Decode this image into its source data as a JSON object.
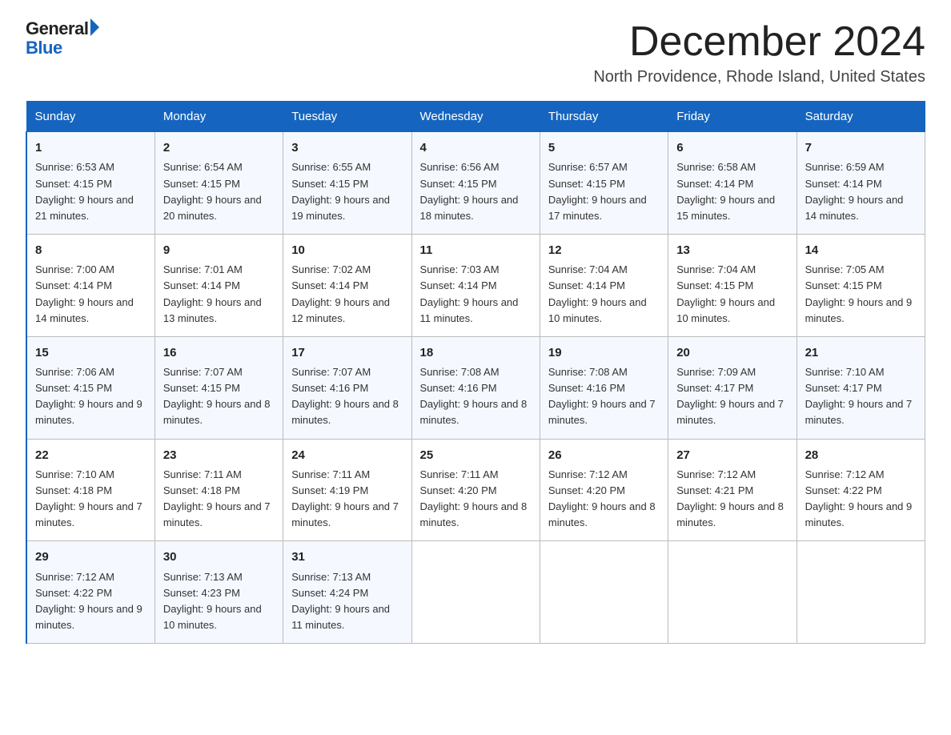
{
  "logo": {
    "general": "General",
    "arrow": "",
    "blue": "Blue"
  },
  "title": "December 2024",
  "subtitle": "North Providence, Rhode Island, United States",
  "headers": [
    "Sunday",
    "Monday",
    "Tuesday",
    "Wednesday",
    "Thursday",
    "Friday",
    "Saturday"
  ],
  "weeks": [
    [
      {
        "day": "1",
        "sunrise": "Sunrise: 6:53 AM",
        "sunset": "Sunset: 4:15 PM",
        "daylight": "Daylight: 9 hours and 21 minutes."
      },
      {
        "day": "2",
        "sunrise": "Sunrise: 6:54 AM",
        "sunset": "Sunset: 4:15 PM",
        "daylight": "Daylight: 9 hours and 20 minutes."
      },
      {
        "day": "3",
        "sunrise": "Sunrise: 6:55 AM",
        "sunset": "Sunset: 4:15 PM",
        "daylight": "Daylight: 9 hours and 19 minutes."
      },
      {
        "day": "4",
        "sunrise": "Sunrise: 6:56 AM",
        "sunset": "Sunset: 4:15 PM",
        "daylight": "Daylight: 9 hours and 18 minutes."
      },
      {
        "day": "5",
        "sunrise": "Sunrise: 6:57 AM",
        "sunset": "Sunset: 4:15 PM",
        "daylight": "Daylight: 9 hours and 17 minutes."
      },
      {
        "day": "6",
        "sunrise": "Sunrise: 6:58 AM",
        "sunset": "Sunset: 4:14 PM",
        "daylight": "Daylight: 9 hours and 15 minutes."
      },
      {
        "day": "7",
        "sunrise": "Sunrise: 6:59 AM",
        "sunset": "Sunset: 4:14 PM",
        "daylight": "Daylight: 9 hours and 14 minutes."
      }
    ],
    [
      {
        "day": "8",
        "sunrise": "Sunrise: 7:00 AM",
        "sunset": "Sunset: 4:14 PM",
        "daylight": "Daylight: 9 hours and 14 minutes."
      },
      {
        "day": "9",
        "sunrise": "Sunrise: 7:01 AM",
        "sunset": "Sunset: 4:14 PM",
        "daylight": "Daylight: 9 hours and 13 minutes."
      },
      {
        "day": "10",
        "sunrise": "Sunrise: 7:02 AM",
        "sunset": "Sunset: 4:14 PM",
        "daylight": "Daylight: 9 hours and 12 minutes."
      },
      {
        "day": "11",
        "sunrise": "Sunrise: 7:03 AM",
        "sunset": "Sunset: 4:14 PM",
        "daylight": "Daylight: 9 hours and 11 minutes."
      },
      {
        "day": "12",
        "sunrise": "Sunrise: 7:04 AM",
        "sunset": "Sunset: 4:14 PM",
        "daylight": "Daylight: 9 hours and 10 minutes."
      },
      {
        "day": "13",
        "sunrise": "Sunrise: 7:04 AM",
        "sunset": "Sunset: 4:15 PM",
        "daylight": "Daylight: 9 hours and 10 minutes."
      },
      {
        "day": "14",
        "sunrise": "Sunrise: 7:05 AM",
        "sunset": "Sunset: 4:15 PM",
        "daylight": "Daylight: 9 hours and 9 minutes."
      }
    ],
    [
      {
        "day": "15",
        "sunrise": "Sunrise: 7:06 AM",
        "sunset": "Sunset: 4:15 PM",
        "daylight": "Daylight: 9 hours and 9 minutes."
      },
      {
        "day": "16",
        "sunrise": "Sunrise: 7:07 AM",
        "sunset": "Sunset: 4:15 PM",
        "daylight": "Daylight: 9 hours and 8 minutes."
      },
      {
        "day": "17",
        "sunrise": "Sunrise: 7:07 AM",
        "sunset": "Sunset: 4:16 PM",
        "daylight": "Daylight: 9 hours and 8 minutes."
      },
      {
        "day": "18",
        "sunrise": "Sunrise: 7:08 AM",
        "sunset": "Sunset: 4:16 PM",
        "daylight": "Daylight: 9 hours and 8 minutes."
      },
      {
        "day": "19",
        "sunrise": "Sunrise: 7:08 AM",
        "sunset": "Sunset: 4:16 PM",
        "daylight": "Daylight: 9 hours and 7 minutes."
      },
      {
        "day": "20",
        "sunrise": "Sunrise: 7:09 AM",
        "sunset": "Sunset: 4:17 PM",
        "daylight": "Daylight: 9 hours and 7 minutes."
      },
      {
        "day": "21",
        "sunrise": "Sunrise: 7:10 AM",
        "sunset": "Sunset: 4:17 PM",
        "daylight": "Daylight: 9 hours and 7 minutes."
      }
    ],
    [
      {
        "day": "22",
        "sunrise": "Sunrise: 7:10 AM",
        "sunset": "Sunset: 4:18 PM",
        "daylight": "Daylight: 9 hours and 7 minutes."
      },
      {
        "day": "23",
        "sunrise": "Sunrise: 7:11 AM",
        "sunset": "Sunset: 4:18 PM",
        "daylight": "Daylight: 9 hours and 7 minutes."
      },
      {
        "day": "24",
        "sunrise": "Sunrise: 7:11 AM",
        "sunset": "Sunset: 4:19 PM",
        "daylight": "Daylight: 9 hours and 7 minutes."
      },
      {
        "day": "25",
        "sunrise": "Sunrise: 7:11 AM",
        "sunset": "Sunset: 4:20 PM",
        "daylight": "Daylight: 9 hours and 8 minutes."
      },
      {
        "day": "26",
        "sunrise": "Sunrise: 7:12 AM",
        "sunset": "Sunset: 4:20 PM",
        "daylight": "Daylight: 9 hours and 8 minutes."
      },
      {
        "day": "27",
        "sunrise": "Sunrise: 7:12 AM",
        "sunset": "Sunset: 4:21 PM",
        "daylight": "Daylight: 9 hours and 8 minutes."
      },
      {
        "day": "28",
        "sunrise": "Sunrise: 7:12 AM",
        "sunset": "Sunset: 4:22 PM",
        "daylight": "Daylight: 9 hours and 9 minutes."
      }
    ],
    [
      {
        "day": "29",
        "sunrise": "Sunrise: 7:12 AM",
        "sunset": "Sunset: 4:22 PM",
        "daylight": "Daylight: 9 hours and 9 minutes."
      },
      {
        "day": "30",
        "sunrise": "Sunrise: 7:13 AM",
        "sunset": "Sunset: 4:23 PM",
        "daylight": "Daylight: 9 hours and 10 minutes."
      },
      {
        "day": "31",
        "sunrise": "Sunrise: 7:13 AM",
        "sunset": "Sunset: 4:24 PM",
        "daylight": "Daylight: 9 hours and 11 minutes."
      },
      null,
      null,
      null,
      null
    ]
  ]
}
